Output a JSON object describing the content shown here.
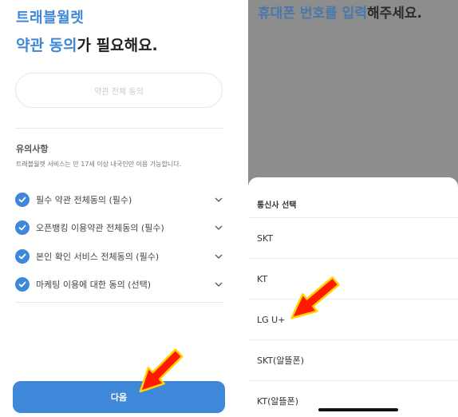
{
  "left": {
    "brand": "트래블월렛",
    "headline_accent": "약관 동의",
    "headline_rest": "가 필요해요.",
    "agree_all_label": "약관 전체 동의",
    "notice_title": "유의사항",
    "notice_text": "트래블월렛 서비스는 만 17세 이상 내국인만 이용 가능합니다.",
    "terms": [
      {
        "label": "필수 약관 전체동의 (필수)",
        "checked": true
      },
      {
        "label": "오픈뱅킹 이용약관 전체동의 (필수)",
        "checked": true
      },
      {
        "label": "본인 확인 서비스 전체동의 (필수)",
        "checked": true
      },
      {
        "label": "마케팅 이용에 대한 동의 (선택)",
        "checked": true
      }
    ],
    "next_button": "다음"
  },
  "right": {
    "title_accent": "휴대폰 번호를 입력",
    "title_rest": "해주세요.",
    "sheet_title": "통신사 선택",
    "carriers": [
      "SKT",
      "KT",
      "LG U+",
      "SKT(알뜰폰)",
      "KT(알뜰폰)"
    ]
  },
  "colors": {
    "accent": "#3f87d9",
    "overlay": "#8d8d8d",
    "arrow_red": "#ff1a00",
    "arrow_yellow": "#ffd400"
  },
  "icons": [
    "check-icon",
    "chevron-down-icon",
    "pointer-arrow-icon"
  ]
}
